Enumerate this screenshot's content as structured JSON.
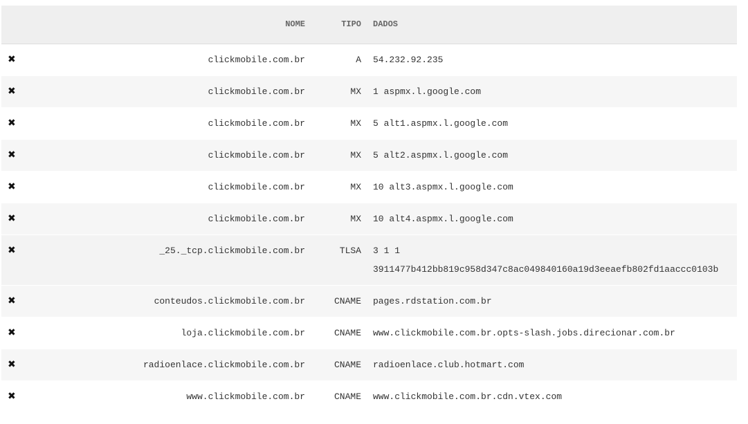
{
  "table": {
    "headers": {
      "nome": "NOME",
      "tipo": "TIPO",
      "dados": "DADOS"
    },
    "delete_icon": "✖",
    "rows": [
      {
        "nome": "clickmobile.com.br",
        "tipo": "A",
        "dados": [
          "54.232.92.235"
        ]
      },
      {
        "nome": "clickmobile.com.br",
        "tipo": "MX",
        "dados": [
          "1 aspmx.l.google.com"
        ]
      },
      {
        "nome": "clickmobile.com.br",
        "tipo": "MX",
        "dados": [
          "5 alt1.aspmx.l.google.com"
        ]
      },
      {
        "nome": "clickmobile.com.br",
        "tipo": "MX",
        "dados": [
          "5 alt2.aspmx.l.google.com"
        ]
      },
      {
        "nome": "clickmobile.com.br",
        "tipo": "MX",
        "dados": [
          "10 alt3.aspmx.l.google.com"
        ]
      },
      {
        "nome": "clickmobile.com.br",
        "tipo": "MX",
        "dados": [
          "10 alt4.aspmx.l.google.com"
        ]
      },
      {
        "nome": "_25._tcp.clickmobile.com.br",
        "tipo": "TLSA",
        "dados": [
          "3 1 1",
          "3911477b412bb819c958d347c8ac049840160a19d3eeaefb802fd1aaccc0103b"
        ]
      },
      {
        "nome": "conteudos.clickmobile.com.br",
        "tipo": "CNAME",
        "dados": [
          "pages.rdstation.com.br"
        ]
      },
      {
        "nome": "loja.clickmobile.com.br",
        "tipo": "CNAME",
        "dados": [
          "www.clickmobile.com.br.opts-slash.jobs.direcionar.com.br"
        ]
      },
      {
        "nome": "radioenlace.clickmobile.com.br",
        "tipo": "CNAME",
        "dados": [
          "radioenlace.club.hotmart.com"
        ]
      },
      {
        "nome": "www.clickmobile.com.br",
        "tipo": "CNAME",
        "dados": [
          "www.clickmobile.com.br.cdn.vtex.com"
        ]
      }
    ]
  }
}
